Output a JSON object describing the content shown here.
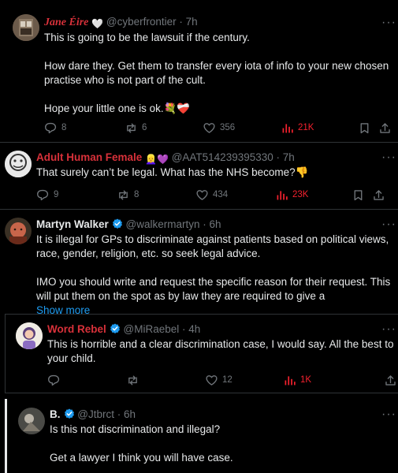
{
  "tweets": [
    {
      "name": "Jane Éire",
      "heart_emoji": "🤍",
      "handle": "@cyberfrontier",
      "time": "7h",
      "lines": [
        "This is going to be the lawsuit if the century.",
        "",
        "How dare they. Get them to transfer every iota of info to your new chosen",
        "practise who is not part of the cult.",
        "",
        "Hope your little one is ok.💐❤️‍🩹"
      ],
      "replies": "8",
      "reposts": "6",
      "likes": "356",
      "views": "21K",
      "name_color": "#d8313a"
    },
    {
      "name": "Adult Human Female",
      "name_emojis": "👱‍♀️💜",
      "handle": "@AAT514239395330",
      "time": "7h",
      "lines": [
        "That surely can’t be legal.  What has the NHS become?👎"
      ],
      "replies": "9",
      "reposts": "8",
      "likes": "434",
      "views": "23K",
      "name_color": "#d8313a"
    },
    {
      "name": "Martyn Walker",
      "handle": "@walkermartyn",
      "time": "6h",
      "lines": [
        "It is illegal for GPs to discriminate against patients based on political views,",
        "race, gender, religion, etc. so seek legal advice.",
        "",
        "IMO you should write and request the specific reason for their request. This",
        "will put them on the spot as by law they are required to give a"
      ],
      "show_more": "Show more",
      "verified": true
    },
    {
      "name": "Word Rebel",
      "handle": "@MiRaebel",
      "time": "4h",
      "lines": [
        "This is horrible and a clear discrimination case, I would say. All the best to",
        "your child."
      ],
      "replies": "",
      "reposts": "",
      "likes": "12",
      "views": "1K",
      "verified": true,
      "name_color": "#d8313a"
    },
    {
      "name": "B.",
      "handle": "@Jtbrct",
      "time": "6h",
      "lines": [
        "Is this not discrimination and illegal?",
        "",
        "Get a lawyer I think you will have case."
      ],
      "verified": true
    }
  ],
  "colors": {
    "accent_blue": "#1d9bf0",
    "views_red": "#f4212e",
    "muted": "#71767b"
  },
  "icons": [
    "reply-icon",
    "repost-icon",
    "like-icon",
    "views-icon",
    "bookmark-icon",
    "share-icon",
    "more-icon",
    "verified-badge-icon"
  ]
}
